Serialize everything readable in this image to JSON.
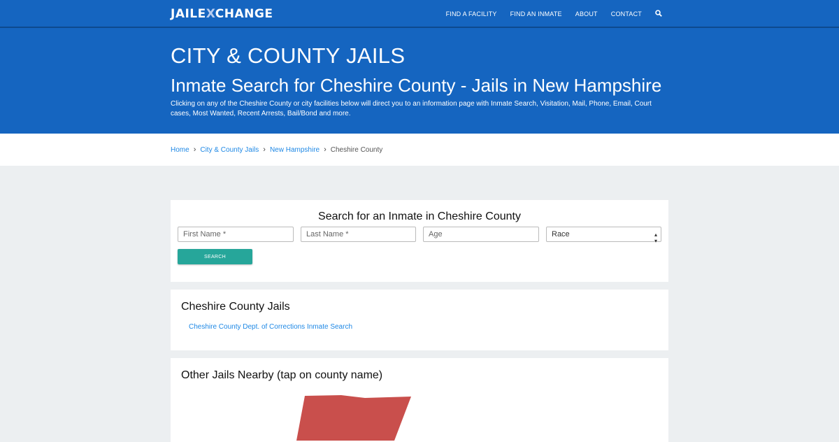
{
  "nav": {
    "logo_part1": "JAIL",
    "logo_part2": "E",
    "logo_x": "X",
    "logo_part3": "CHANGE",
    "links": [
      "FIND A FACILITY",
      "FIND AN INMATE",
      "ABOUT",
      "CONTACT"
    ],
    "search_icon": "search-icon"
  },
  "hero": {
    "kicker": "CITY & COUNTY JAILS",
    "headline": "Inmate Search for Cheshire County - Jails in New Hampshire",
    "description": "Clicking on any of the Cheshire County or city facilities below will direct you to an information page with Inmate Search, Visitation, Mail, Phone, Email, Court cases, Most Wanted, Recent Arrests, Bail/Bond and more."
  },
  "breadcrumb": {
    "items": [
      "Home",
      "City & County Jails",
      "New Hampshire"
    ],
    "current": "Cheshire County"
  },
  "search_form": {
    "title": "Search for an Inmate in Cheshire County",
    "first_name_placeholder": "First Name *",
    "last_name_placeholder": "Last Name *",
    "age_placeholder": "Age",
    "race_selected": "Race",
    "button": "SEARCH"
  },
  "jails_card": {
    "title": "Cheshire County Jails",
    "link": "Cheshire County Dept. of Corrections Inmate Search"
  },
  "nearby_card": {
    "title": "Other Jails Nearby (tap on county name)"
  },
  "colors": {
    "primary_blue": "#1565c0",
    "button_teal": "#26a69a",
    "link_blue": "#1e88e5",
    "map_red": "#c94f4c"
  }
}
